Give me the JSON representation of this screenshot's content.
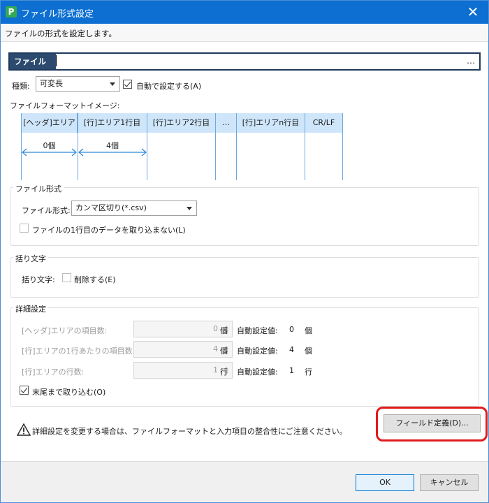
{
  "window": {
    "title": "ファイル形式設定",
    "app_icon_letter": "P",
    "subtitle": "ファイルの形式を設定します。",
    "close_glyph": "✕"
  },
  "file_name": {
    "label": "ファイル名:",
    "value": "",
    "browse_label": "…"
  },
  "kind": {
    "label": "種類:",
    "value": "可変長",
    "auto_label": "自動で設定する(A)",
    "auto_checked": true
  },
  "format_image": {
    "label": "ファイルフォーマットイメージ:",
    "cells": [
      "[ヘッダ]エリア",
      "[行]エリア1行目",
      "[行]エリア2行目",
      "…",
      "[行]エリアn行目",
      "CR/LF"
    ],
    "header_count": "0個",
    "row_count": "4個"
  },
  "file_format": {
    "group_title": "ファイル形式",
    "label": "ファイル形式:",
    "value": "カンマ区切り(*.csv)",
    "skip_first_label": "ファイルの1行目のデータを取り込まない(L)",
    "skip_first_checked": false
  },
  "quote": {
    "group_title": "括り文字",
    "label": "括り文字:",
    "remove_label": "削除する(E)",
    "remove_checked": false
  },
  "details": {
    "group_title": "詳細設定",
    "rows": [
      {
        "label": "[ヘッダ]エリアの項目数:",
        "value": "0",
        "unit": "個",
        "auto_label": "自動設定値:",
        "auto_value": "0",
        "auto_unit": "個"
      },
      {
        "label": "[行]エリアの1行あたりの項目数:",
        "value": "4",
        "unit": "個",
        "auto_label": "自動設定値:",
        "auto_value": "4",
        "auto_unit": "個"
      },
      {
        "label": "[行]エリアの行数:",
        "value": "1",
        "unit": "行",
        "auto_label": "自動設定値:",
        "auto_value": "1",
        "auto_unit": "行"
      }
    ],
    "to_end_label": "末尾まで取り込む(O)",
    "to_end_checked": true
  },
  "field_def_button": "フィールド定義(D)...",
  "warning_text": "詳細設定を変更する場合は、ファイルフォーマットと入力項目の整合性にご注意ください。",
  "footer": {
    "ok": "OK",
    "cancel": "キャンセル"
  },
  "colors": {
    "titlebar": "#0c6fd1",
    "diagram_fill": "#cfe6fa",
    "highlight": "#e11b1b"
  }
}
